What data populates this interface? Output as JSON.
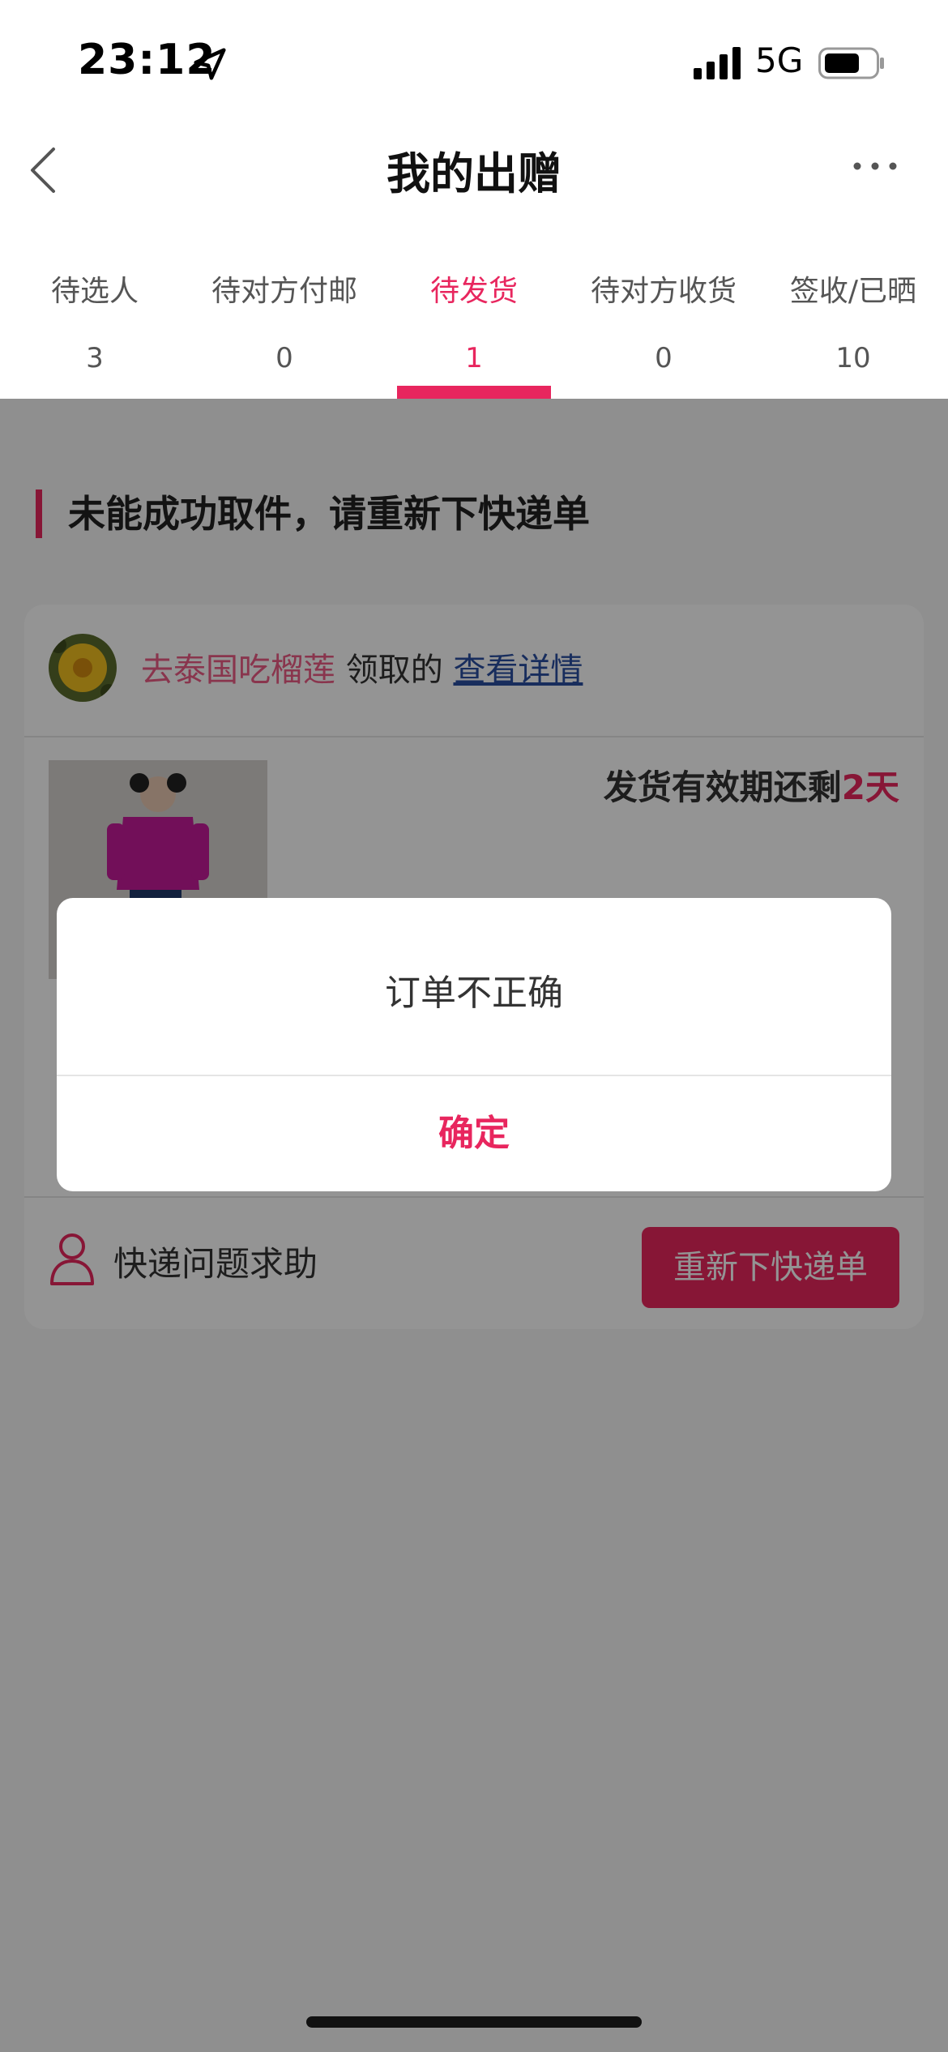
{
  "status_bar": {
    "time": "23:12",
    "network": "5G"
  },
  "nav": {
    "title": "我的出赠"
  },
  "tabs": [
    {
      "label": "待选人",
      "count": "3",
      "active": false
    },
    {
      "label": "待对方付邮",
      "count": "0",
      "active": false
    },
    {
      "label": "待发货",
      "count": "1",
      "active": true
    },
    {
      "label": "待对方收货",
      "count": "0",
      "active": false
    },
    {
      "label": "签收/已晒",
      "count": "10",
      "active": false
    }
  ],
  "section": {
    "title": "未能成功取件，请重新下快递单"
  },
  "card": {
    "receiver_name": "去泰国吃榴莲",
    "receiver_mid": "领取的",
    "details_link": "查看详情",
    "deadline_prefix": "发货有效期还剩",
    "deadline_value": "2天",
    "help_text": "快递问题求助",
    "reorder_button": "重新下快递单"
  },
  "dialog": {
    "message": "订单不正确",
    "confirm": "确定"
  },
  "colors": {
    "accent": "#e8265e",
    "link": "#2a4fa0"
  }
}
